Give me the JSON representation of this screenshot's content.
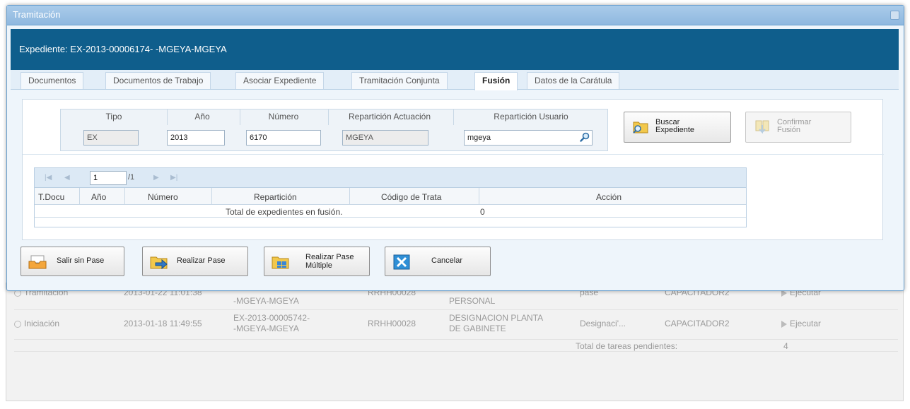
{
  "modal": {
    "title": "Tramitación",
    "expediente_label": "Expediente: EX-2013-00006174- -MGEYA-MGEYA"
  },
  "tabs": [
    {
      "label": "Documentos"
    },
    {
      "label": "Documentos de Trabajo"
    },
    {
      "label": "Asociar Expediente"
    },
    {
      "label": "Tramitación Conjunta"
    },
    {
      "label": "Fusión"
    },
    {
      "label": "Datos de la Carátula"
    }
  ],
  "search": {
    "headers": {
      "tipo": "Tipo",
      "anio": "Año",
      "numero": "Número",
      "reparticion_actuacion": "Repartición Actuación",
      "reparticion_usuario": "Repartición Usuario"
    },
    "values": {
      "tipo": "EX",
      "anio": "2013",
      "numero": "6170",
      "reparticion_actuacion": "MGEYA",
      "reparticion_usuario": "mgeya"
    },
    "buscar_label_1": "Buscar",
    "buscar_label_2": "Expediente",
    "confirmar_label_1": "Confirmar",
    "confirmar_label_2": "Fusión"
  },
  "results": {
    "page_value": "1",
    "page_of": "/1",
    "columns": [
      "T.Docu",
      "Año",
      "Número",
      "Repartición",
      "Código de Trata",
      "Acción"
    ],
    "total_label": "Total de expedientes en fusión.",
    "total_value": "0"
  },
  "footer": {
    "salir_label": "Salir sin Pase",
    "realizar_label": "Realizar Pase",
    "multiple_label_1": "Realizar Pase",
    "multiple_label_2": "Múltiple",
    "cancelar_label": "Cancelar"
  },
  "background": {
    "row1": {
      "estado": "Tramitación",
      "fecha": "2013-01-22 11:01:38",
      "expediente": "-MGEYA-MGEYA",
      "reparticion": "RRHH00028",
      "motivo": "PERSONAL",
      "tarea": "pase",
      "usuario": "CAPACITADOR2",
      "accion": "Ejecutar"
    },
    "row2": {
      "estado": "Iniciación",
      "fecha": "2013-01-18 11:49:55",
      "expediente_1": "EX-2013-00005742-",
      "expediente_2": "-MGEYA-MGEYA",
      "reparticion": "RRHH00028",
      "motivo_1": "DESIGNACION PLANTA",
      "motivo_2": "DE GABINETE",
      "tarea": "Designaci'...",
      "usuario": "CAPACITADOR2",
      "accion": "Ejecutar"
    },
    "total_label": "Total de tareas pendientes:",
    "total_value": "4"
  },
  "colors": {
    "expediente_bar": "#0f5e8c",
    "title_bar": "#8fb8df",
    "pager_bg": "#dce9f5"
  }
}
